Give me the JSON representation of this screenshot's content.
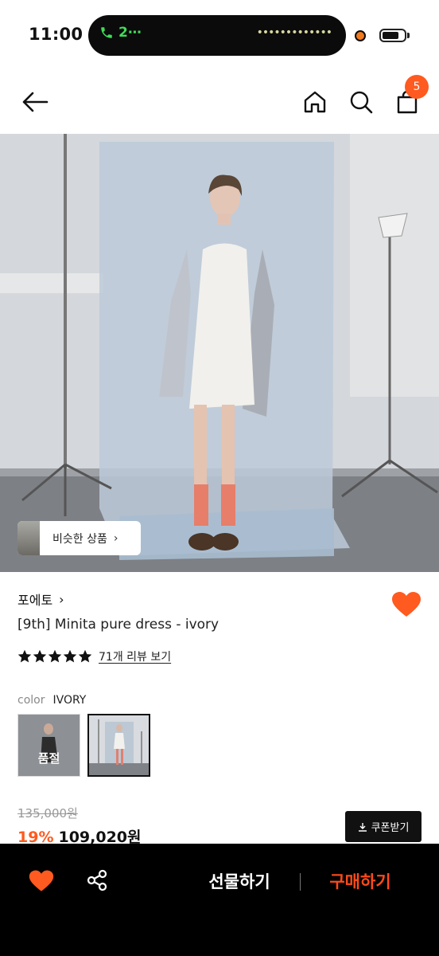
{
  "status_bar": {
    "time": "11:00",
    "call_label": "2⋯",
    "call_color": "#3fdc58"
  },
  "nav": {
    "icons": [
      "back-arrow-icon",
      "home-icon",
      "search-icon",
      "shopping-bag-icon"
    ],
    "cart_count": "5",
    "badge_color": "#ff5a1f"
  },
  "hero": {
    "similar_label": "비슷한 상품",
    "similar_chevron": "›"
  },
  "product": {
    "brand": "포에토",
    "brand_chevron": "›",
    "name": "[9th] Minita pure dress - ivory",
    "rating_stars": 5,
    "review_link": "71개 리뷰 보기",
    "liked": true,
    "accent_color": "#ff5a1f"
  },
  "options": {
    "color_key": "color",
    "color_value": "IVORY",
    "swatches": [
      {
        "state": "품절"
      },
      {
        "state": ""
      }
    ]
  },
  "price": {
    "original": "135,000원",
    "discount": "19%",
    "final": "109,020원",
    "coupon_label": "쿠폰받기"
  },
  "bottom_bar": {
    "icons": [
      "heart-icon",
      "share-icon"
    ],
    "gift_label": "선물하기",
    "buy_label": "구매하기",
    "buy_color": "#ff4a1a"
  }
}
